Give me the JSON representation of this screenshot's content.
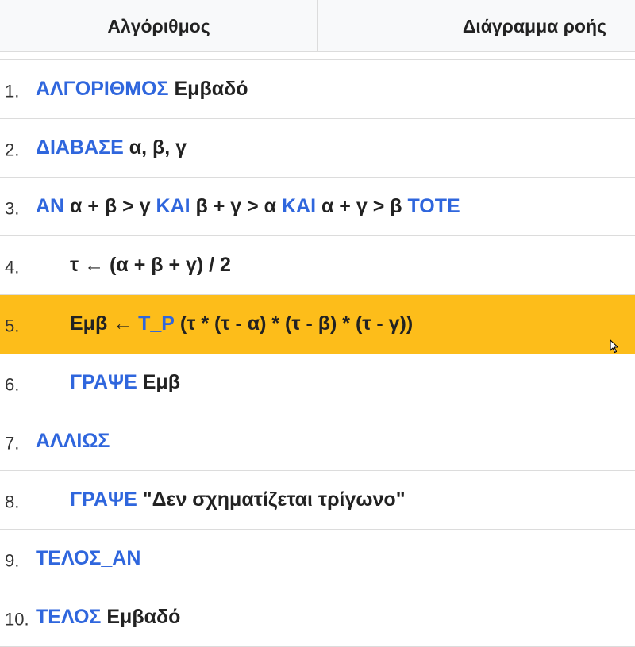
{
  "tabs": {
    "algorithm": "Αλγόριθμος",
    "flowchart": "Διάγραμμα ροής"
  },
  "colors": {
    "keyword": "#2f66dd",
    "highlight": "#fdbd1a",
    "text": "#222222"
  },
  "code": {
    "highlighted_line": 5,
    "lines": [
      {
        "num": "1.",
        "parts": {
          "k1": "ΑΛΓΟΡΙΘΜΟΣ",
          "t1": " Εμβαδό"
        }
      },
      {
        "num": "2.",
        "parts": {
          "k1": "ΔΙΑΒΑΣΕ",
          "t1": " α, β, γ"
        }
      },
      {
        "num": "3.",
        "parts": {
          "k1": "ΑΝ",
          "t1": " α + β > γ ",
          "k2": "ΚΑΙ",
          "t2": " β + γ > α ",
          "k3": "ΚΑΙ",
          "t3": " α + γ > β ",
          "k4": "ΤΟΤΕ"
        }
      },
      {
        "num": "4.",
        "parts": {
          "t1": "τ ← (α + β + γ) / 2"
        }
      },
      {
        "num": "5.",
        "parts": {
          "t1": "Εμβ ← ",
          "k1": "Τ_Ρ",
          "t2": " (τ * (τ - α) * (τ - β) * (τ - γ))"
        }
      },
      {
        "num": "6.",
        "parts": {
          "k1": "ΓΡΑΨΕ",
          "t1": " Εμβ"
        }
      },
      {
        "num": "7.",
        "parts": {
          "k1": "ΑΛΛΙΩΣ"
        }
      },
      {
        "num": "8.",
        "parts": {
          "k1": "ΓΡΑΨΕ",
          "t1": " \"Δεν σχηματίζεται τρίγωνο\""
        }
      },
      {
        "num": "9.",
        "parts": {
          "k1": "ΤΕΛΟΣ_ΑΝ"
        }
      },
      {
        "num": "10.",
        "parts": {
          "k1": "ΤΕΛΟΣ",
          "t1": " Εμβαδό"
        }
      }
    ]
  }
}
